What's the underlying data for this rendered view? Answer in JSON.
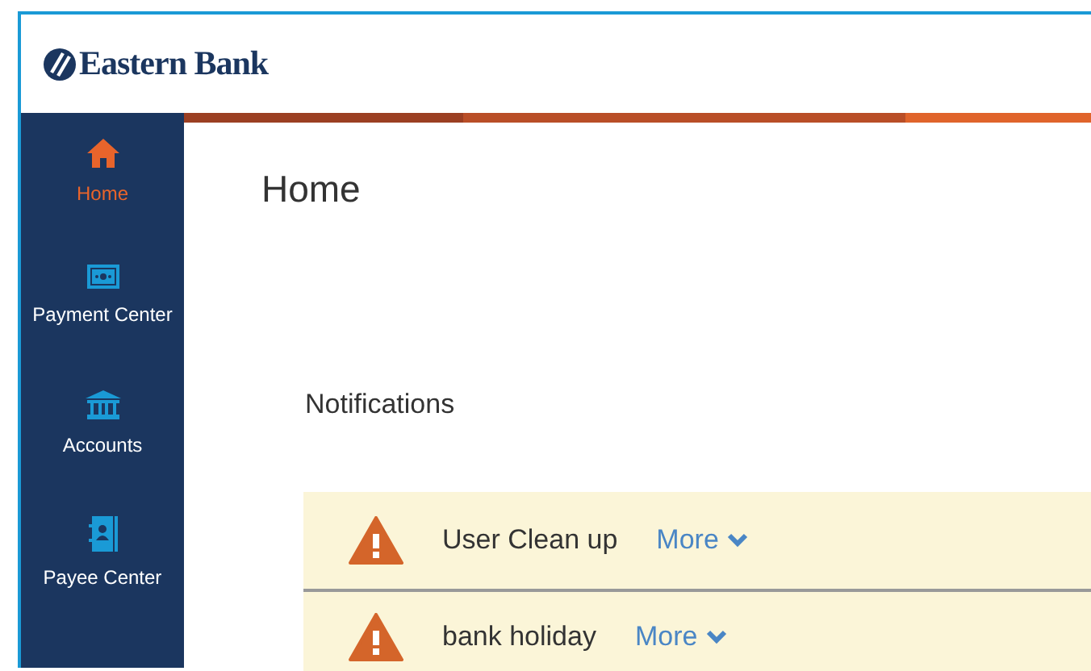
{
  "header": {
    "logo_text": "Eastern Bank"
  },
  "sidebar": {
    "items": [
      {
        "label": "Home",
        "kind": "home",
        "selected": true
      },
      {
        "label": "Payment Center",
        "kind": "payment",
        "selected": false
      },
      {
        "label": "Accounts",
        "kind": "bank",
        "selected": false
      },
      {
        "label": "Payee Center",
        "kind": "contacts",
        "selected": false
      }
    ]
  },
  "page_title": "Home",
  "notifications": {
    "title": "Notifications",
    "items": [
      {
        "text": "User Clean up",
        "link": "More"
      },
      {
        "text": "bank holiday",
        "link": "More"
      }
    ]
  }
}
